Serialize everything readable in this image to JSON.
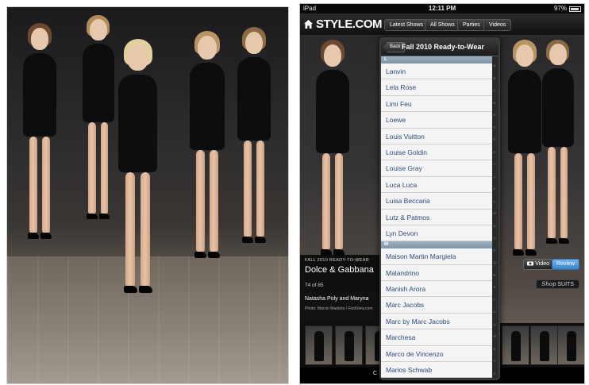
{
  "status_bar": {
    "device": "iPad",
    "time": "12:11 PM",
    "battery": "97%"
  },
  "nav": {
    "logo": "STYLE.COM",
    "buttons": [
      "Latest Shows",
      "All Shows",
      "Parties",
      "Videos"
    ]
  },
  "popover": {
    "back_label": "Back",
    "title": "Fall 2010 Ready-to-Wear",
    "sections": [
      {
        "letter": "L",
        "items": [
          "Lanvin",
          "Lela Rose",
          "Limi Feu",
          "Loewe",
          "Louis Vuitton",
          "Louise Goldin",
          "Louise Gray",
          "Luca Luca",
          "Luisa Beccaria",
          "Lutz & Patmos",
          "Lyn Devon"
        ]
      },
      {
        "letter": "M",
        "items": [
          "Maison Martin Margiela",
          "Malandrino",
          "Manish Arora",
          "Marc Jacobs",
          "Marc by Marc Jacobs",
          "Marchesa",
          "Marco de Vincenzo",
          "Marios Schwab"
        ]
      }
    ],
    "index_letters": [
      "A",
      "B",
      "C",
      "D",
      "E",
      "F",
      "G",
      "H",
      "I",
      "J",
      "K",
      "L",
      "M",
      "N",
      "O",
      "P",
      "Q",
      "R",
      "S",
      "T",
      "U",
      "V",
      "W",
      "X",
      "Y",
      "Z",
      "#"
    ]
  },
  "info": {
    "season": "FALL 2010 READY-TO-WEAR",
    "designer": "Dolce & Gabbana",
    "count": "74 of 85",
    "models": "Natasha Poly and Maryna",
    "photo_credit": "Photo: Marcio Madeira / FirstView.com"
  },
  "actions": {
    "video_label": "Video",
    "review_label": "Review",
    "shop_prefix": "Shop",
    "shop_label": "SUITS"
  },
  "bottom": {
    "label": "C"
  },
  "colors": {
    "review_blue": "#4a90d6",
    "section_header": "#8ea2b4",
    "list_text": "#2d4c7a"
  }
}
